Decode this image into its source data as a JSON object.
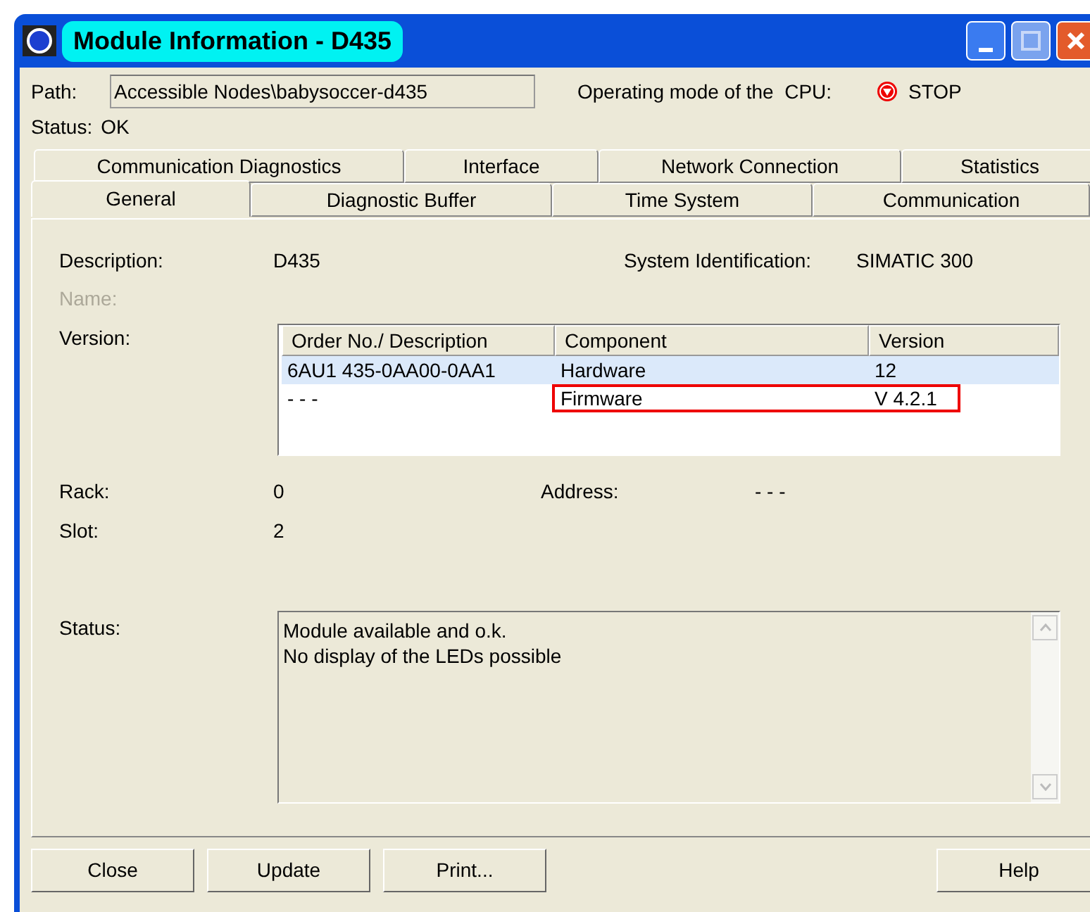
{
  "window": {
    "title": "Module Information - D435"
  },
  "path": {
    "label": "Path:",
    "value": "Accessible Nodes\\babysoccer-d435"
  },
  "operating_mode": {
    "label": "Operating mode of the  CPU:",
    "value": "STOP"
  },
  "status_line": {
    "label": "Status:",
    "value": "OK"
  },
  "tab_rows": [
    [
      {
        "label": "Communication Diagnostics",
        "selected": false
      },
      {
        "label": "Interface",
        "selected": false
      },
      {
        "label": "Network Connection",
        "selected": false
      },
      {
        "label": "Statistics",
        "selected": false
      }
    ],
    [
      {
        "label": "General",
        "selected": true
      },
      {
        "label": "Diagnostic Buffer",
        "selected": false
      },
      {
        "label": "Time System",
        "selected": false
      },
      {
        "label": "Communication",
        "selected": false
      }
    ]
  ],
  "general": {
    "description_label": "Description:",
    "description": "D435",
    "system_id_label": "System Identification:",
    "system_id": "SIMATIC 300",
    "name_label": "Name:",
    "version_label": "Version:",
    "table": {
      "columns": [
        "Order No./ Description",
        "Component",
        "Version"
      ],
      "rows": [
        {
          "cells": [
            "6AU1 435-0AA00-0AA1",
            "Hardware",
            "12"
          ],
          "selected": true,
          "highlighted": false
        },
        {
          "cells": [
            "- - -",
            "Firmware",
            "V 4.2.1"
          ],
          "selected": false,
          "highlighted": true
        }
      ]
    },
    "rack_label": "Rack:",
    "rack": "0",
    "address_label": "Address:",
    "address": "- - -",
    "slot_label": "Slot:",
    "slot": "2",
    "status_label": "Status:",
    "status_lines": [
      "Module available and o.k.",
      "No display of the LEDs possible"
    ]
  },
  "left_buttons": [
    "Close",
    "Update",
    "Print..."
  ],
  "right_buttons": [
    "Help"
  ]
}
